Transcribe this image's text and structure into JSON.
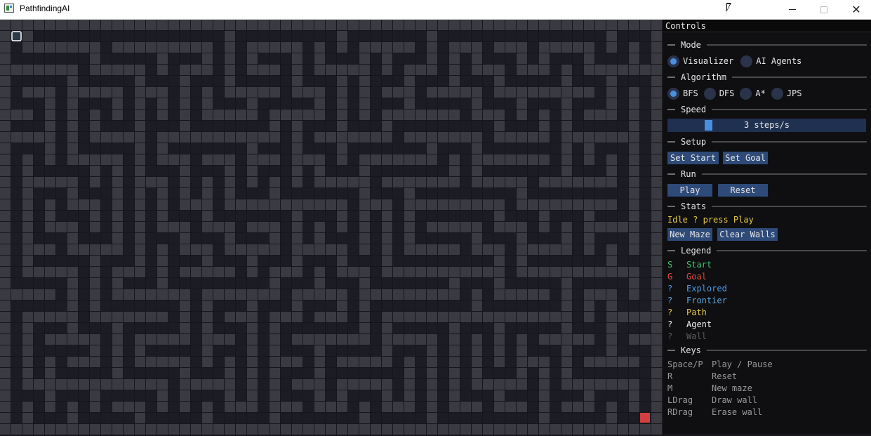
{
  "window": {
    "title": "PathfindingAI"
  },
  "panel": {
    "title": "Controls",
    "mode": {
      "heading": "Mode",
      "options": [
        {
          "label": "Visualizer",
          "selected": true
        },
        {
          "label": "AI Agents",
          "selected": false
        }
      ]
    },
    "algorithm": {
      "heading": "Algorithm",
      "options": [
        {
          "label": "BFS",
          "selected": true
        },
        {
          "label": "DFS",
          "selected": false
        },
        {
          "label": "A*",
          "selected": false
        },
        {
          "label": "JPS",
          "selected": false
        }
      ]
    },
    "speed": {
      "heading": "Speed",
      "value_text": "3 steps/s"
    },
    "setup": {
      "heading": "Setup",
      "set_start": "Set Start",
      "set_goal": "Set Goal"
    },
    "run": {
      "heading": "Run",
      "play": "Play",
      "reset": "Reset"
    },
    "stats": {
      "heading": "Stats",
      "status": "Idle ? press Play",
      "new_maze": "New Maze",
      "clear_walls": "Clear Walls"
    },
    "legend": {
      "heading": "Legend",
      "items": [
        {
          "symbol": "S",
          "label": "Start",
          "color": "#3ec46a"
        },
        {
          "symbol": "G",
          "label": "Goal",
          "color": "#e0463a"
        },
        {
          "symbol": "?",
          "label": "Explored",
          "color": "#4a9be8"
        },
        {
          "symbol": "?",
          "label": "Frontier",
          "color": "#5aa7e0"
        },
        {
          "symbol": "?",
          "label": "Path",
          "color": "#e6c84a"
        },
        {
          "symbol": "?",
          "label": "Agent",
          "color": "#f0f0f0"
        },
        {
          "symbol": "?",
          "label": "Wall",
          "color": "#5c5c5c"
        }
      ]
    },
    "keys": {
      "heading": "Keys",
      "items": [
        {
          "key": "Space/P",
          "action": "Play / Pause"
        },
        {
          "key": "R",
          "action": "Reset"
        },
        {
          "key": "M",
          "action": "New maze"
        },
        {
          "key": "LDrag",
          "action": "Draw wall"
        },
        {
          "key": "RDrag",
          "action": "Erase wall"
        }
      ]
    }
  },
  "maze": {
    "colors": {
      "wall": "#3a3a42",
      "open": "#1c1c24",
      "grid": "#26262c",
      "start": "#2a3a4a",
      "goal": "#d04040"
    }
  }
}
